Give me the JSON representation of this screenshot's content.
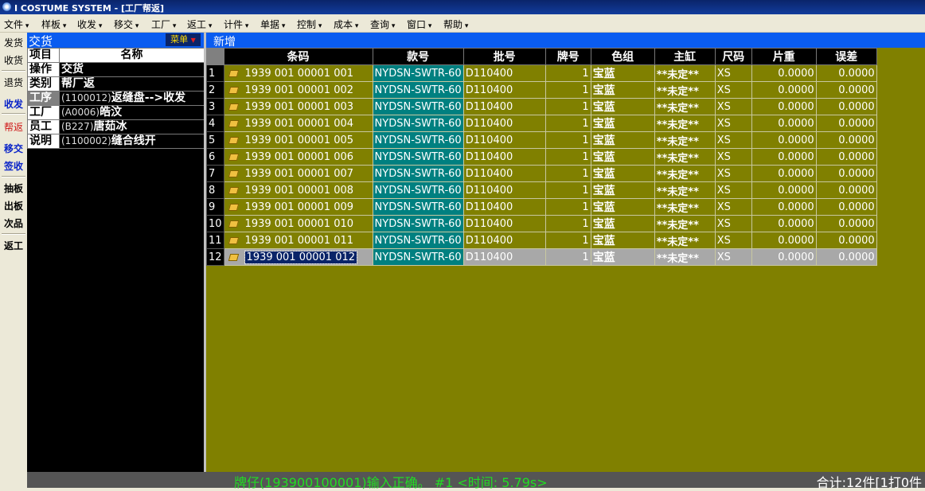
{
  "window": {
    "title": "I COSTUME SYSTEM - [工厂帮返]"
  },
  "menu": [
    "文件",
    "样板",
    "收发",
    "移交",
    "工厂",
    "返工",
    "计件",
    "单据",
    "控制",
    "成本",
    "查询",
    "窗口",
    "帮助"
  ],
  "left_toolbar": [
    {
      "label": "发货",
      "style": ""
    },
    {
      "label": "收货",
      "style": ""
    },
    {
      "label": "退货",
      "style": ""
    },
    {
      "label": "收发",
      "style": "blue"
    },
    {
      "label": "帮返",
      "style": "red"
    },
    {
      "label": "移交",
      "style": "blue"
    },
    {
      "label": "签收",
      "style": "blue"
    },
    {
      "label": "抽板",
      "style": "bold"
    },
    {
      "label": "出板",
      "style": "bold"
    },
    {
      "label": "次品",
      "style": "bold"
    },
    {
      "label": "返工",
      "style": "bold"
    }
  ],
  "left_panel": {
    "title": "交货",
    "menu_button": "菜单",
    "headers": [
      "项目",
      "名称"
    ],
    "rows": [
      {
        "key": "操作",
        "code": "",
        "value": "交货",
        "selected": false
      },
      {
        "key": "类别",
        "code": "",
        "value": "帮厂返",
        "selected": false
      },
      {
        "key": "工序",
        "code": "(1100012)",
        "value": "返缝盘-->收发",
        "selected": true
      },
      {
        "key": "工厂",
        "code": "(A0006)",
        "value": "皓汶",
        "selected": false
      },
      {
        "key": "员工",
        "code": "(B227)",
        "value": "唐茹冰",
        "selected": false
      },
      {
        "key": "说明",
        "code": "(1100002)",
        "value": "缝合线开",
        "selected": false
      }
    ]
  },
  "right_panel": {
    "new_label": "新增"
  },
  "grid": {
    "columns": [
      "",
      "条码",
      "款号",
      "批号",
      "牌号",
      "色组",
      "主缸",
      "尺码",
      "片重",
      "误差"
    ],
    "rows": [
      [
        "1",
        "1939 001 00001 001",
        "NYDSN-SWTR-60",
        "D110400",
        "1",
        "宝蓝",
        "**未定**",
        "XS",
        "0.0000",
        "0.0000"
      ],
      [
        "2",
        "1939 001 00001 002",
        "NYDSN-SWTR-60",
        "D110400",
        "1",
        "宝蓝",
        "**未定**",
        "XS",
        "0.0000",
        "0.0000"
      ],
      [
        "3",
        "1939 001 00001 003",
        "NYDSN-SWTR-60",
        "D110400",
        "1",
        "宝蓝",
        "**未定**",
        "XS",
        "0.0000",
        "0.0000"
      ],
      [
        "4",
        "1939 001 00001 004",
        "NYDSN-SWTR-60",
        "D110400",
        "1",
        "宝蓝",
        "**未定**",
        "XS",
        "0.0000",
        "0.0000"
      ],
      [
        "5",
        "1939 001 00001 005",
        "NYDSN-SWTR-60",
        "D110400",
        "1",
        "宝蓝",
        "**未定**",
        "XS",
        "0.0000",
        "0.0000"
      ],
      [
        "6",
        "1939 001 00001 006",
        "NYDSN-SWTR-60",
        "D110400",
        "1",
        "宝蓝",
        "**未定**",
        "XS",
        "0.0000",
        "0.0000"
      ],
      [
        "7",
        "1939 001 00001 007",
        "NYDSN-SWTR-60",
        "D110400",
        "1",
        "宝蓝",
        "**未定**",
        "XS",
        "0.0000",
        "0.0000"
      ],
      [
        "8",
        "1939 001 00001 008",
        "NYDSN-SWTR-60",
        "D110400",
        "1",
        "宝蓝",
        "**未定**",
        "XS",
        "0.0000",
        "0.0000"
      ],
      [
        "9",
        "1939 001 00001 009",
        "NYDSN-SWTR-60",
        "D110400",
        "1",
        "宝蓝",
        "**未定**",
        "XS",
        "0.0000",
        "0.0000"
      ],
      [
        "10",
        "1939 001 00001 010",
        "NYDSN-SWTR-60",
        "D110400",
        "1",
        "宝蓝",
        "**未定**",
        "XS",
        "0.0000",
        "0.0000"
      ],
      [
        "11",
        "1939 001 00001 011",
        "NYDSN-SWTR-60",
        "D110400",
        "1",
        "宝蓝",
        "**未定**",
        "XS",
        "0.0000",
        "0.0000"
      ],
      [
        "12",
        "1939 001 00001 012",
        "NYDSN-SWTR-60",
        "D110400",
        "1",
        "宝蓝",
        "**未定**",
        "XS",
        "0.0000",
        "0.0000"
      ]
    ],
    "current_row": 11
  },
  "status": {
    "message": "牌仔(193900100001)输入正确。 #1 <时间: 5.79s>",
    "total": "合计:12件[1打0件"
  },
  "colors": {
    "grid_bg": "#808000",
    "header_blue": "#0a5cf0",
    "style_cell": "#008080",
    "status_green": "#22dd22"
  }
}
